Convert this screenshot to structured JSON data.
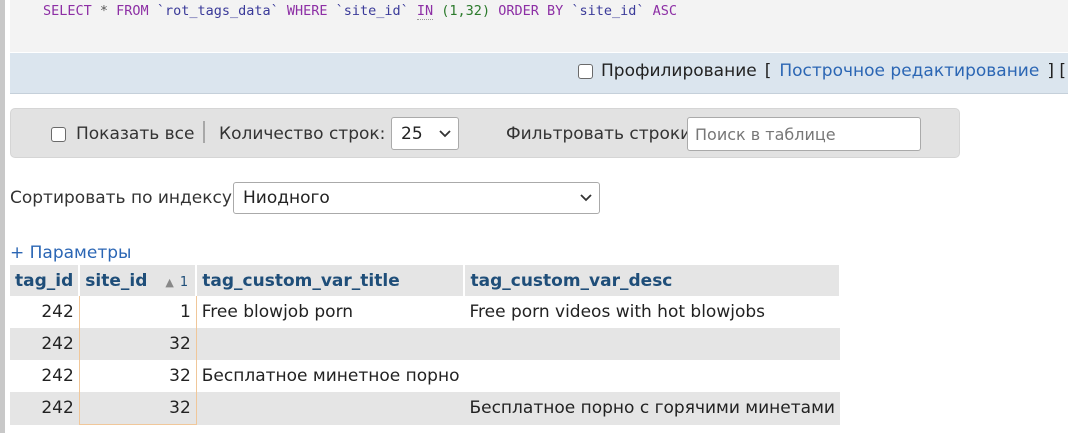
{
  "sql": {
    "select": "SELECT",
    "star": " * ",
    "from": "FROM",
    "table": " `rot_tags_data` ",
    "where": "WHERE",
    "field": " `site_id` ",
    "in": "IN",
    "values": " (1,32) ",
    "order": "ORDER BY",
    "field2": " `site_id` ",
    "asc": "ASC"
  },
  "profiling": {
    "label": "Профилирование",
    "bracket_open": "[",
    "inline_edit": "Построчное редактирование",
    "bracket_close": "] ["
  },
  "nav": {
    "show_all": "Показать все",
    "rows_label": "Количество строк:",
    "rows_value": "25",
    "filter_label": "Фильтровать строки:",
    "search_placeholder": "Поиск в таблице"
  },
  "sort": {
    "label": "Сортировать по индексу:",
    "value": "Ниодного"
  },
  "params_link": "+ Параметры",
  "table": {
    "columns": [
      "tag_id",
      "site_id",
      "tag_custom_var_title",
      "tag_custom_var_desc"
    ],
    "sort_order": "1",
    "rows": [
      {
        "tag_id": "242",
        "site_id": "1",
        "title": "Free blowjob porn",
        "desc": "Free porn videos with hot blowjobs"
      },
      {
        "tag_id": "242",
        "site_id": "32",
        "title": "",
        "desc": ""
      },
      {
        "tag_id": "242",
        "site_id": "32",
        "title": "Бесплатное минетное порно",
        "desc": ""
      },
      {
        "tag_id": "242",
        "site_id": "32",
        "title": "",
        "desc": "Бесплатное порно с горячими минетами"
      }
    ]
  }
}
